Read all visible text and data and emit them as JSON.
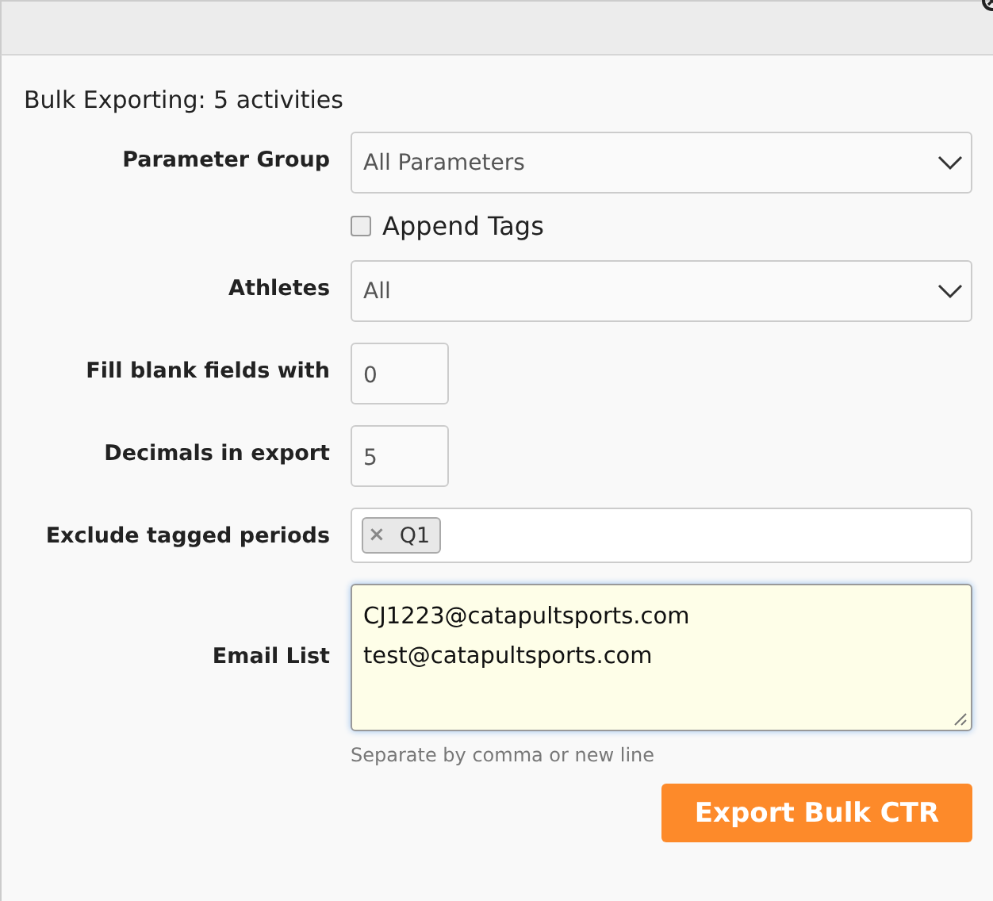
{
  "header": {
    "close": true
  },
  "title": "Bulk Exporting: 5 activities",
  "fields": [
    {
      "kind": "select",
      "label": "Parameter Group",
      "value": "All Parameters"
    },
    {
      "kind": "checkbox",
      "label": "Append Tags",
      "checked": false
    },
    {
      "kind": "select",
      "label": "Athletes",
      "value": "All"
    },
    {
      "kind": "number",
      "label": "Fill blank fields with",
      "value": "0"
    },
    {
      "kind": "number",
      "label": "Decimals in export",
      "value": "5"
    },
    {
      "kind": "tags",
      "label": "Exclude tagged periods",
      "tags": [
        {
          "remove": "×",
          "text": "Q1"
        }
      ]
    },
    {
      "kind": "textarea",
      "label": "Email List",
      "lines": [
        "CJ1223@catapultsports.com",
        "test@catapultsports.com"
      ],
      "hint": "Separate by comma or new line"
    }
  ],
  "button": "Export Bulk CTR"
}
